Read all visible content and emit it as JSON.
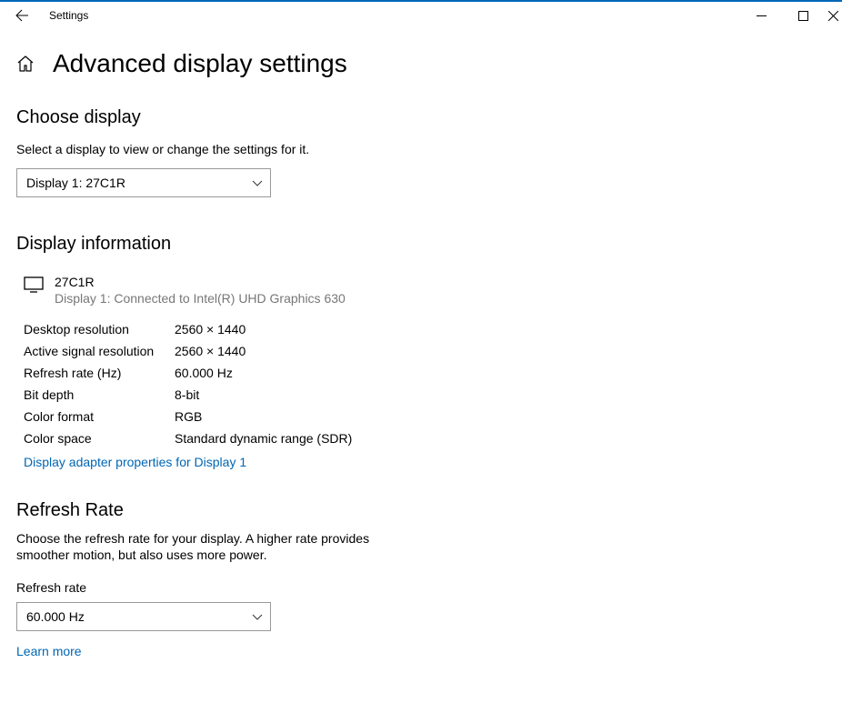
{
  "titlebar": {
    "title": "Settings"
  },
  "header": {
    "pageTitle": "Advanced display settings"
  },
  "chooseDisplay": {
    "heading": "Choose display",
    "subtext": "Select a display to view or change the settings for it.",
    "selected": "Display 1: 27C1R"
  },
  "displayInfo": {
    "heading": "Display information",
    "name": "27C1R",
    "connection": "Display 1: Connected to Intel(R) UHD Graphics 630",
    "rows": [
      {
        "label": "Desktop resolution",
        "value": "2560 × 1440"
      },
      {
        "label": "Active signal resolution",
        "value": "2560 × 1440"
      },
      {
        "label": "Refresh rate (Hz)",
        "value": "60.000 Hz"
      },
      {
        "label": "Bit depth",
        "value": "8-bit"
      },
      {
        "label": "Color format",
        "value": "RGB"
      },
      {
        "label": "Color space",
        "value": "Standard dynamic range (SDR)"
      }
    ],
    "adapterLink": "Display adapter properties for Display 1"
  },
  "refreshRate": {
    "heading": "Refresh Rate",
    "description": "Choose the refresh rate for your display. A higher rate provides smoother motion, but also uses more power.",
    "fieldLabel": "Refresh rate",
    "selected": "60.000 Hz",
    "learnMore": "Learn more"
  }
}
